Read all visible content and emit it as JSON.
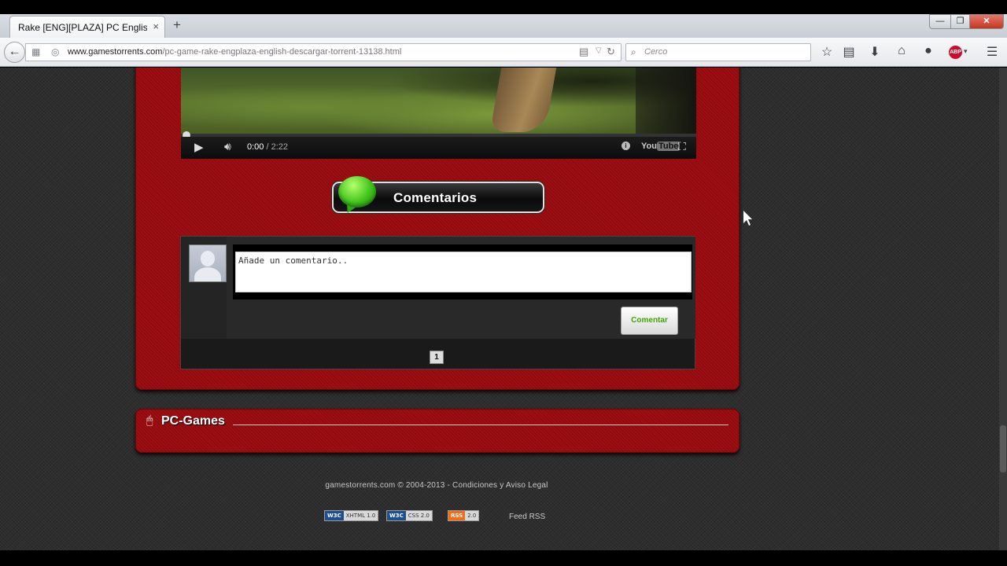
{
  "browser": {
    "tab_title": "Rake [ENG][PLAZA] PC English...",
    "tab_close": "×",
    "new_tab": "+",
    "window_min": "—",
    "window_max": "❐",
    "window_close": "✕",
    "url_host": "www.gamestorrents.com",
    "url_path": "/pc-game-rake-engplaza-english-descargar-torrent-13138.html",
    "search_placeholder": "Cerco",
    "icons": [
      "back-icon",
      "page-info-icon",
      "reader-view-icon",
      "dropdown-icon",
      "reload-icon",
      "search-icon",
      "bookmark-star-icon",
      "bookmarks-list-icon",
      "download-icon",
      "home-icon",
      "chat-icon",
      "adblock-icon",
      "menu-icon"
    ]
  },
  "video": {
    "current_time": "0:00",
    "duration": "/ 2:22",
    "youtube_label": "You",
    "youtube_tube": "Tube",
    "progress": 0
  },
  "comments": {
    "header_label": "Comentarios",
    "textarea_value": "Añade un comentario..",
    "submit_label": "Comentar",
    "page_number": "1"
  },
  "section": {
    "title": "PC-Games"
  },
  "footer": {
    "copyright": "gamestorrents.com © 2004-2013 - Condiciones y Aviso Legal",
    "badges": [
      {
        "left": "W3C",
        "right": "XHTML 1.0",
        "color": "#1e4f8f"
      },
      {
        "left": "W3C",
        "right": "CSS 2.0",
        "color": "#1e4f8f"
      },
      {
        "left": "RSS",
        "right": "2.0",
        "color": "#f26c1a"
      }
    ],
    "feed_label": "Feed RSS"
  },
  "colors": {
    "panel_red": "#9d0d12",
    "comment_green": "#43a300",
    "background": "#2e2e2e"
  }
}
